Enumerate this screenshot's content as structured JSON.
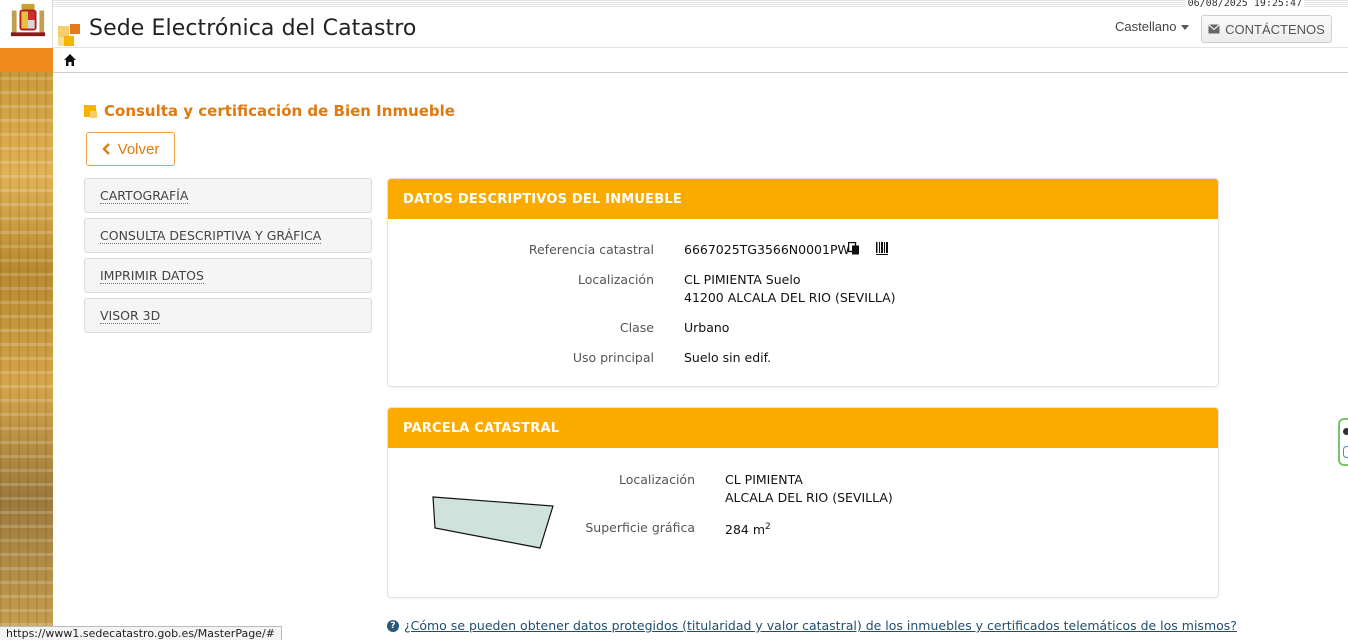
{
  "timestamp": "06/08/2025 19:25:47",
  "header": {
    "site_title": "Sede Electrónica del Catastro",
    "language": "Castellano",
    "contact_label": "CONTÁCTENOS"
  },
  "page": {
    "title": "Consulta y certificación de Bien Inmueble",
    "back_label": "Volver"
  },
  "menu": {
    "items": [
      {
        "label": "CARTOGRAFÍA"
      },
      {
        "label": "CONSULTA DESCRIPTIVA Y GRÁFICA"
      },
      {
        "label": "IMPRIMIR DATOS"
      },
      {
        "label": "VISOR 3D"
      }
    ]
  },
  "inmueble": {
    "heading": "DATOS DESCRIPTIVOS DEL INMUEBLE",
    "referencia_label": "Referencia catastral",
    "referencia_value": "6667025TG3566N0001PW",
    "localizacion_label": "Localización",
    "localizacion_line1": "CL PIMIENTA Suelo",
    "localizacion_line2": "41200 ALCALA DEL RIO (SEVILLA)",
    "clase_label": "Clase",
    "clase_value": "Urbano",
    "uso_label": "Uso principal",
    "uso_value": "Suelo sin edif."
  },
  "parcela": {
    "heading": "PARCELA CATASTRAL",
    "localizacion_label": "Localización",
    "localizacion_line1": "CL PIMIENTA",
    "localizacion_line2": "ALCALA DEL RIO (SEVILLA)",
    "superficie_label": "Superficie gráfica",
    "superficie_value": "284 m",
    "superficie_unit_sup": "2"
  },
  "help": {
    "link_text": "¿Cómo se pueden obtener datos protegidos (titularidad y valor catastral) de los inmuebles y certificados telemáticos de los mismos?"
  },
  "status_bar": {
    "url": "https://www1.sedecatastro.gob.es/MasterPage/#"
  },
  "colors": {
    "accent_orange": "#fbab00",
    "title_orange": "#e07a10",
    "parcel_fill": "#cfe3dc"
  }
}
